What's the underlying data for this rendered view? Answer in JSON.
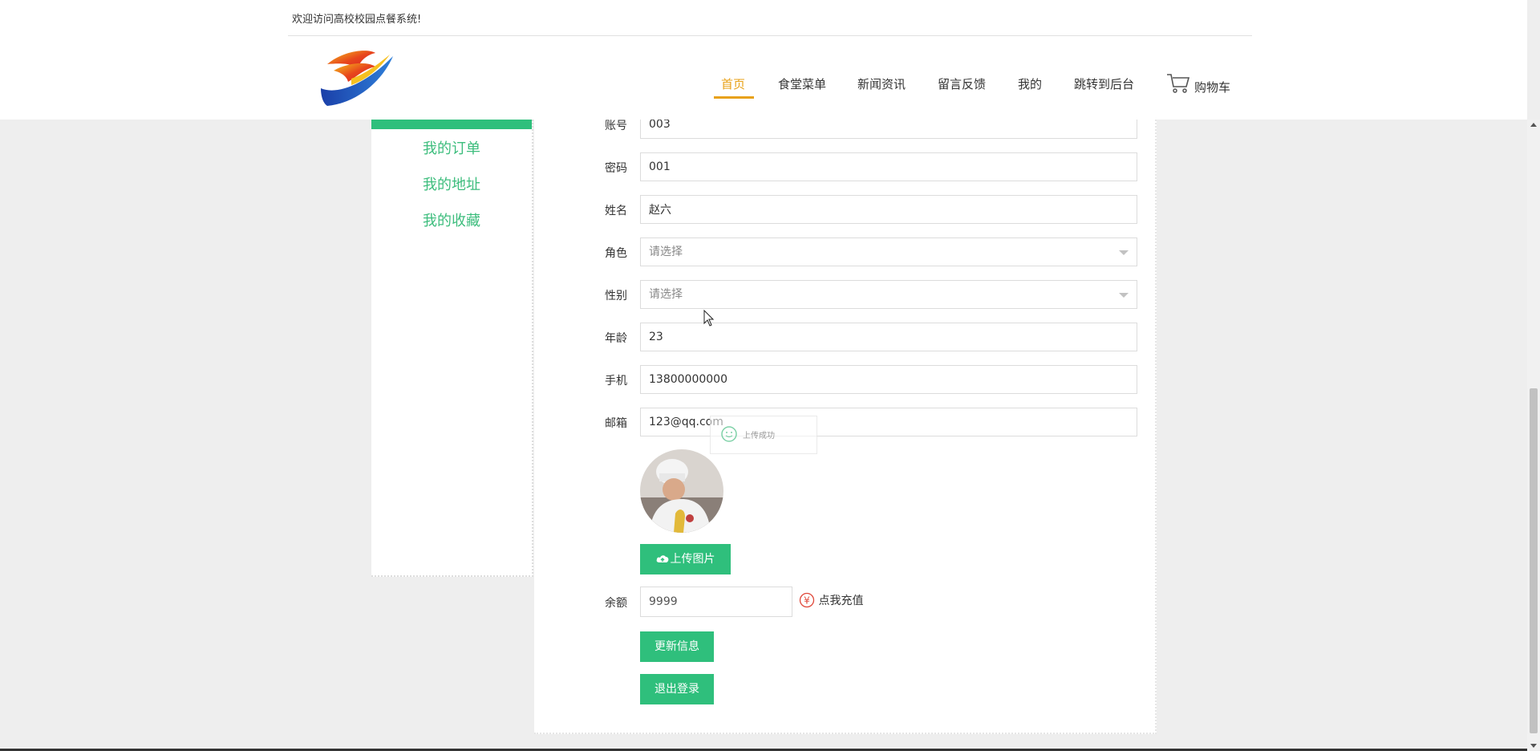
{
  "header": {
    "welcome": "欢迎访问高校校园点餐系统!",
    "nav": [
      "首页",
      "食堂菜单",
      "新闻资讯",
      "留言反馈",
      "我的",
      "跳转到后台"
    ],
    "cart": "购物车",
    "active_color": "#e8a117"
  },
  "sidebar": {
    "items": [
      "我的订单",
      "我的地址",
      "我的收藏"
    ],
    "accent": "#2fbf7c"
  },
  "form": {
    "account": {
      "label": "账号",
      "value": "003"
    },
    "password": {
      "label": "密码",
      "value": "001"
    },
    "name": {
      "label": "姓名",
      "value": "赵六"
    },
    "role": {
      "label": "角色",
      "placeholder": "请选择"
    },
    "gender": {
      "label": "性别",
      "placeholder": "请选择"
    },
    "age": {
      "label": "年龄",
      "value": "23"
    },
    "phone": {
      "label": "手机",
      "value": "13800000000"
    },
    "email": {
      "label": "邮箱",
      "value": "123@qq.com"
    },
    "upload_button": "上传图片",
    "balance": {
      "label": "余额",
      "value": "9999"
    },
    "recharge": "点我充值",
    "update_button": "更新信息",
    "logout_button": "退出登录"
  },
  "toast": {
    "text": "上传成功"
  },
  "icons": [
    "cart-icon",
    "cloud-upload-icon",
    "yuan-icon",
    "smile-icon",
    "cursor-icon"
  ]
}
